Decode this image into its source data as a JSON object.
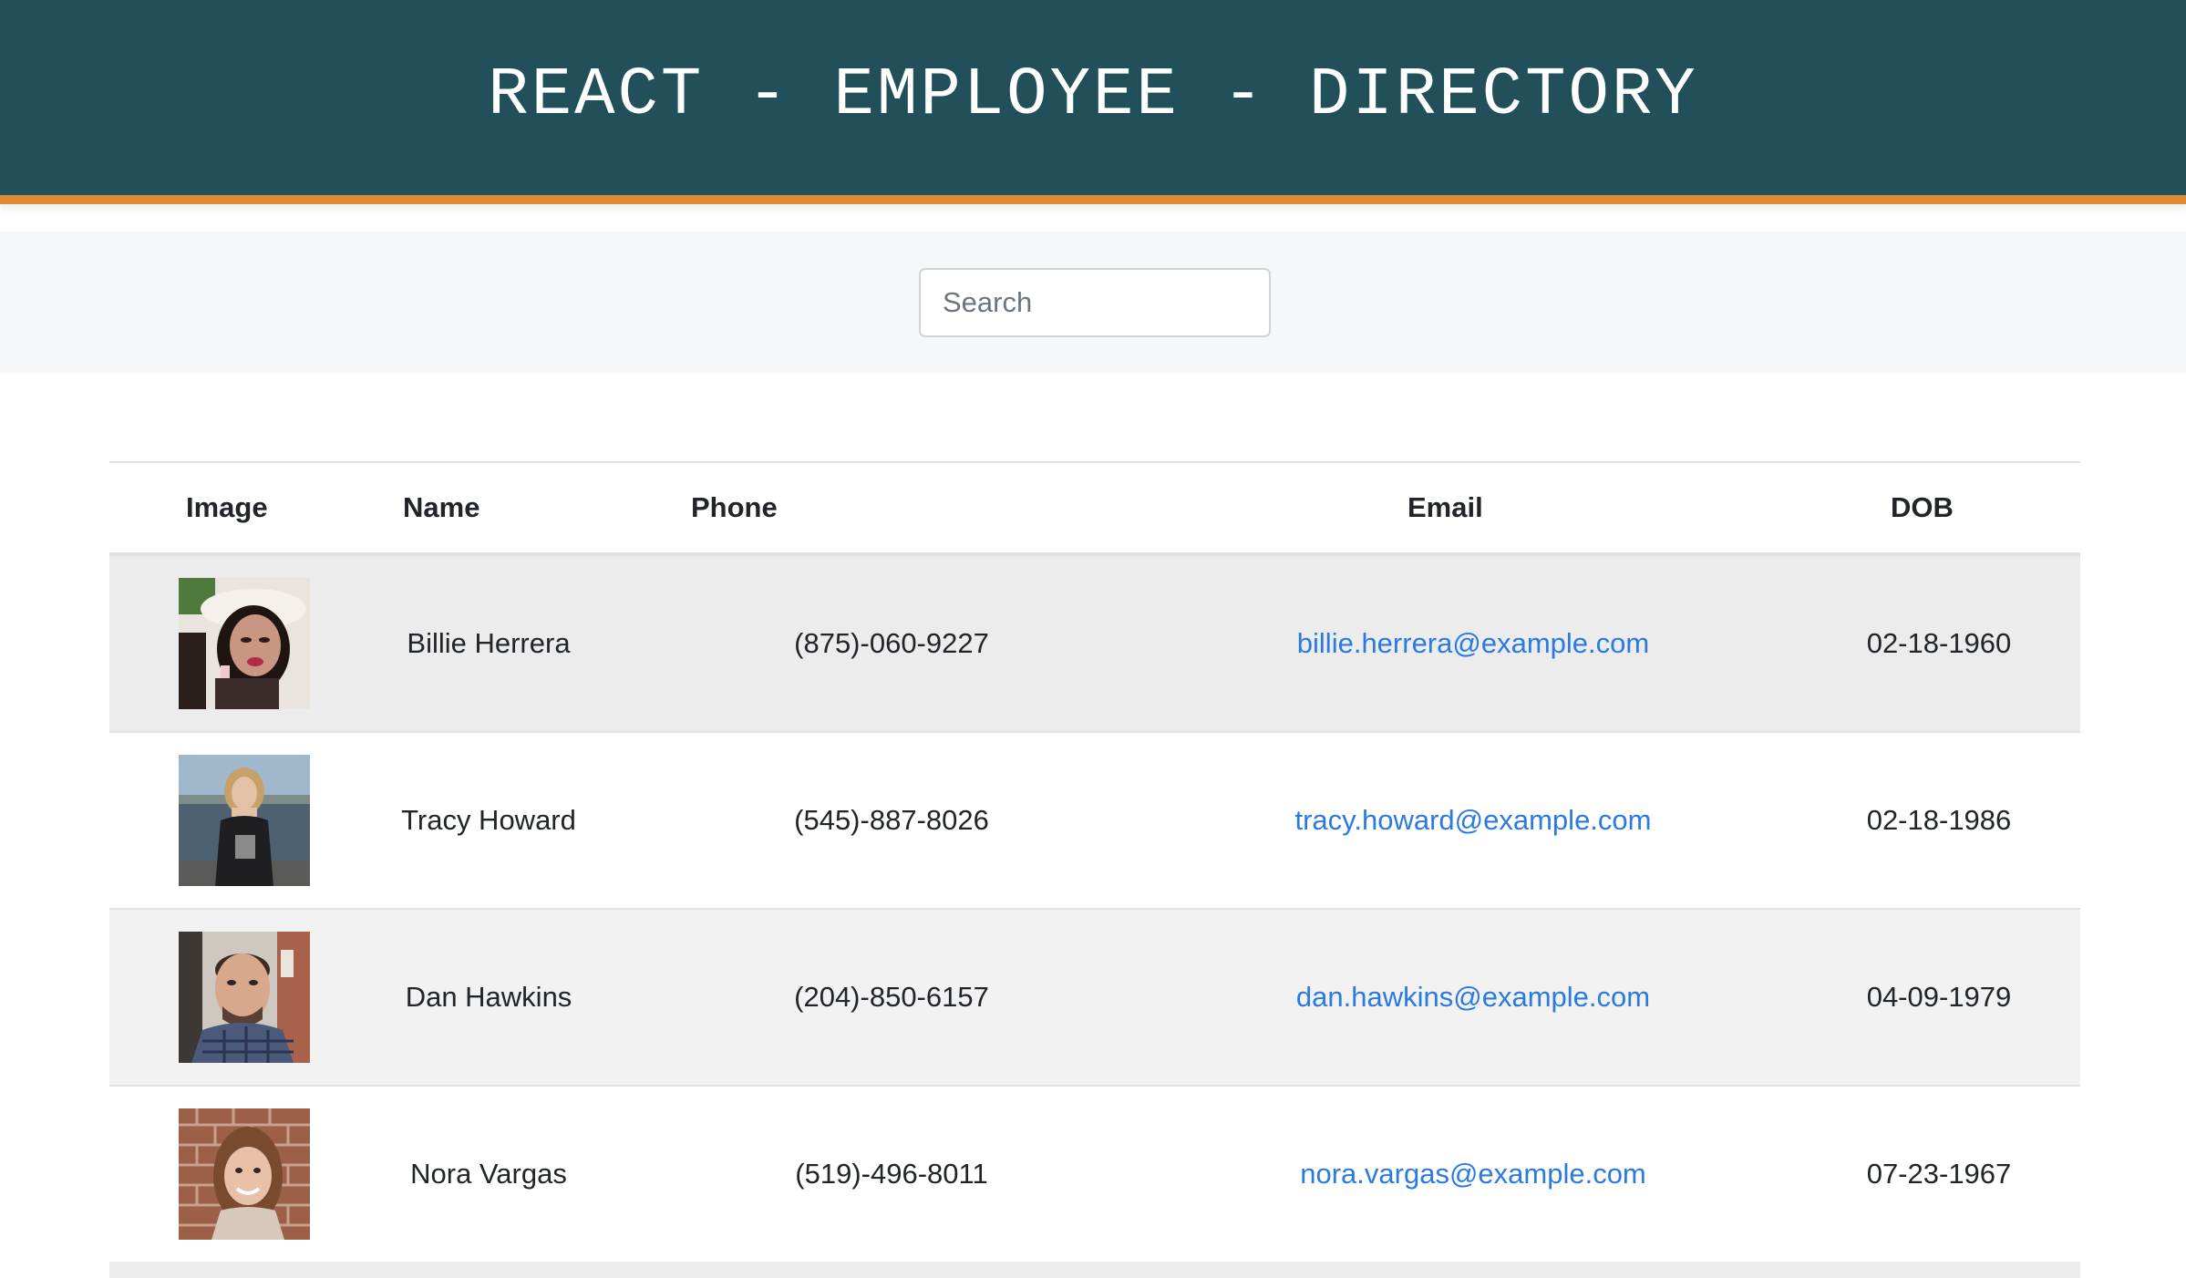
{
  "header": {
    "title": "REACT - EMPLOYEE - DIRECTORY"
  },
  "search": {
    "placeholder": "Search",
    "value": ""
  },
  "colors": {
    "header_bg": "#22505a",
    "header_accent": "#e08a36",
    "link": "#2a7ae2"
  },
  "table": {
    "columns": [
      "Image",
      "Name",
      "Phone",
      "Email",
      "DOB"
    ],
    "rows": [
      {
        "name": "Billie Herrera",
        "phone": "(875)-060-9227",
        "email": "billie.herrera@example.com",
        "dob": "02-18-1960",
        "image": "avatar-photo"
      },
      {
        "name": "Tracy Howard",
        "phone": "(545)-887-8026",
        "email": "tracy.howard@example.com",
        "dob": "02-18-1986",
        "image": "avatar-photo"
      },
      {
        "name": "Dan Hawkins",
        "phone": "(204)-850-6157",
        "email": "dan.hawkins@example.com",
        "dob": "04-09-1979",
        "image": "avatar-photo"
      },
      {
        "name": "Nora Vargas",
        "phone": "(519)-496-8011",
        "email": "nora.vargas@example.com",
        "dob": "07-23-1967",
        "image": "avatar-photo"
      }
    ]
  }
}
